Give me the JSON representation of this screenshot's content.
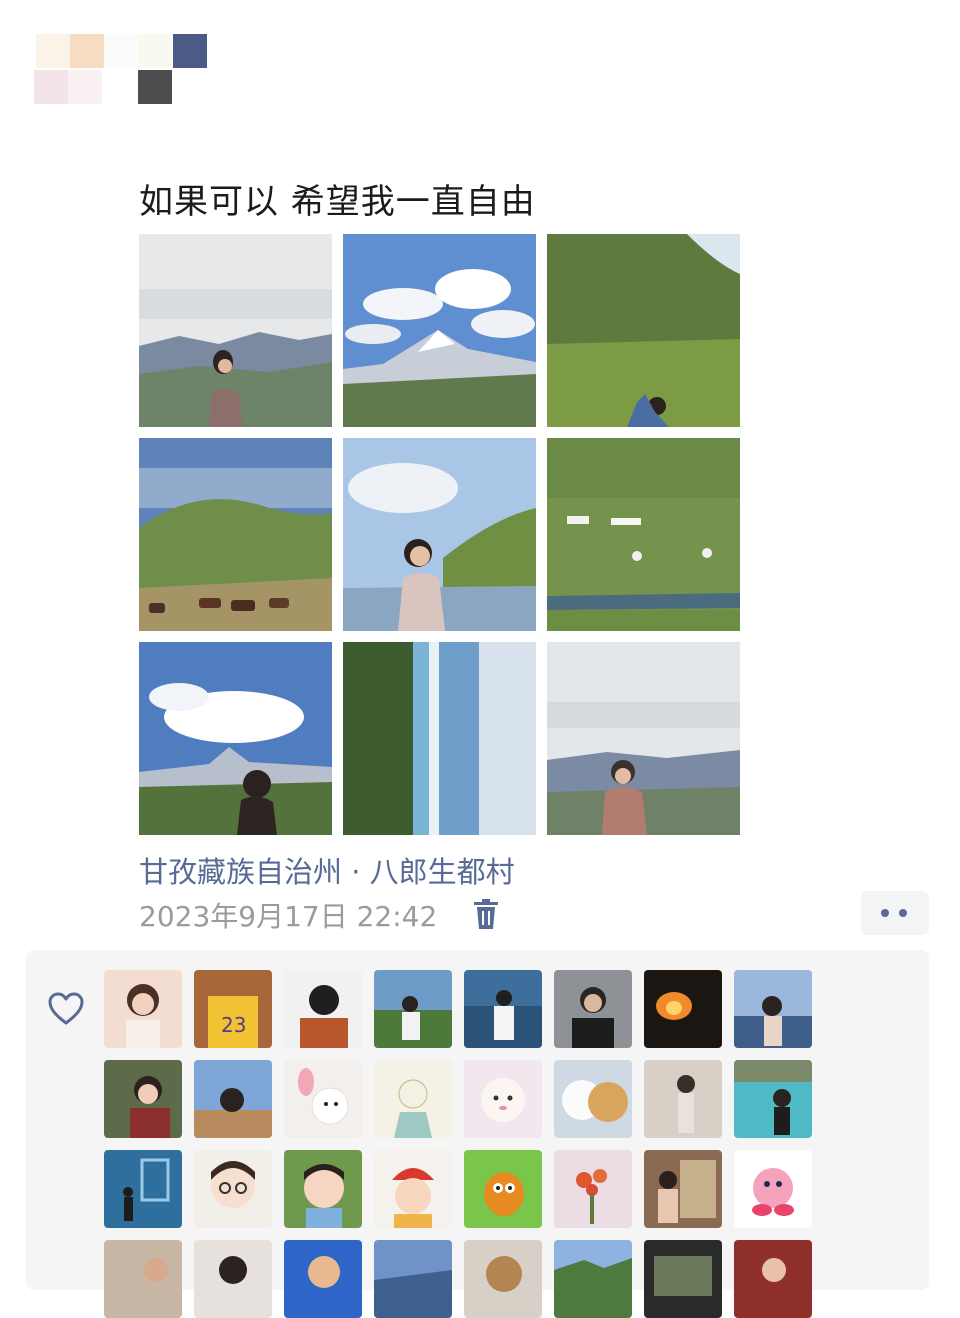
{
  "post": {
    "text": "如果可以 希望我一直自由",
    "location": "甘孜藏族自治州 · 八郎生都村",
    "timestamp": "2023年9月17日 22:42"
  },
  "colors": {
    "link": "#576b95",
    "meta": "#9b9b9b",
    "panel": "#f5f5f5"
  },
  "icons": {
    "delete": "trash-icon",
    "more": "more-dots-icon",
    "like": "heart-icon"
  }
}
